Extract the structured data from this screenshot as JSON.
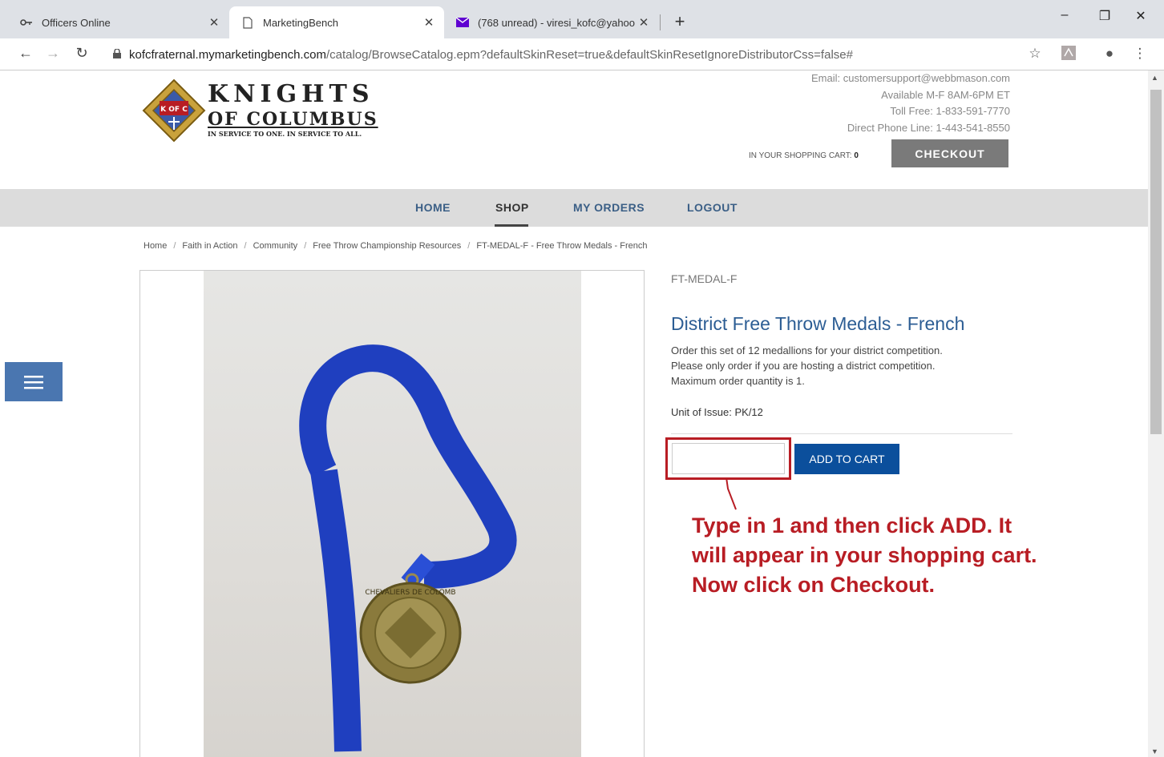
{
  "browser": {
    "tabs": [
      {
        "title": "Officers Online",
        "icon": "key-icon",
        "active": false
      },
      {
        "title": "MarketingBench",
        "icon": "document-icon",
        "active": true
      },
      {
        "title": "(768 unread) - viresi_kofc@yahoo",
        "icon": "mail-icon",
        "active": false
      }
    ],
    "new_tab_symbol": "+",
    "close_symbol": "✕",
    "url_host": "kofcfraternal.mymarketingbench.com",
    "url_path": "/catalog/BrowseCatalog.epm?defaultSkinReset=true&defaultSkinResetIgnoreDistributorCss=false#"
  },
  "header": {
    "logo": {
      "line1": "KNIGHTS",
      "line2": "OF COLUMBUS",
      "line3": "IN SERVICE TO ONE. IN SERVICE TO ALL.",
      "emblem": "K OF C"
    },
    "contact": [
      "Email:  customersupport@webbmason.com",
      "Available M-F 8AM-6PM ET",
      "Toll Free: 1-833-591-7770",
      "Direct Phone Line: 1-443-541-8550"
    ],
    "cart_label": "IN YOUR SHOPPING CART:",
    "cart_count": "0",
    "checkout_label": "CHECKOUT"
  },
  "nav": {
    "items": [
      "HOME",
      "SHOP",
      "MY ORDERS",
      "LOGOUT"
    ],
    "active": "SHOP"
  },
  "breadcrumb": [
    "Home",
    "Faith in Action",
    "Community",
    "Free Throw Championship Resources",
    "FT-MEDAL-F - Free Throw Medals - French"
  ],
  "product": {
    "sku": "FT-MEDAL-F",
    "title": "District Free Throw Medals - French",
    "description_lines": [
      "Order this set of 12 medallions for your district competition.",
      "Please only order if you are hosting a district competition.",
      "Maximum order quantity is 1."
    ],
    "unit": "Unit of Issue: PK/12",
    "quantity_value": "",
    "add_label": "ADD TO CART",
    "medal_text": "CHEVALIERS DE COLOMB"
  },
  "annotation": {
    "lines": [
      "Type in 1 and then click ADD.  It",
      "will appear in your shopping cart.",
      "Now click on Checkout."
    ],
    "color": "#b81d24"
  },
  "colors": {
    "ribbon": "#1f3fbf",
    "medal": "#8a7a3c",
    "nav_blue": "#3b5f86",
    "add_btn": "#0b4f9c"
  }
}
